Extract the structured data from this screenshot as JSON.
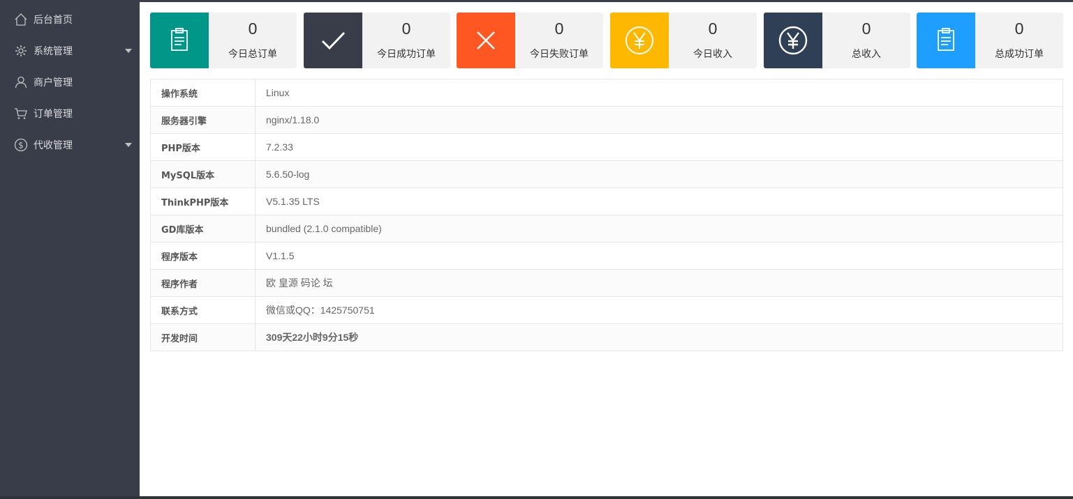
{
  "sidebar": {
    "items": [
      {
        "label": "后台首页",
        "icon": "home-icon",
        "has_submenu": false
      },
      {
        "label": "系统管理",
        "icon": "gear-icon",
        "has_submenu": true
      },
      {
        "label": "商户管理",
        "icon": "user-icon",
        "has_submenu": false
      },
      {
        "label": "订单管理",
        "icon": "cart-icon",
        "has_submenu": false
      },
      {
        "label": "代收管理",
        "icon": "dollar-icon",
        "has_submenu": true
      }
    ]
  },
  "stats": [
    {
      "value": "0",
      "label": "今日总订单",
      "icon": "clipboard-icon",
      "color": "#009688"
    },
    {
      "value": "0",
      "label": "今日成功订单",
      "icon": "check-icon",
      "color": "#393d49"
    },
    {
      "value": "0",
      "label": "今日失败订单",
      "icon": "close-icon",
      "color": "#ff5722"
    },
    {
      "value": "0",
      "label": "今日收入",
      "icon": "yen-icon",
      "color": "#ffb800"
    },
    {
      "value": "0",
      "label": "总收入",
      "icon": "yen-circle-icon",
      "color": "#2f4056"
    },
    {
      "value": "0",
      "label": "总成功订单",
      "icon": "clipboard-icon",
      "color": "#1e9fff"
    }
  ],
  "info_table": [
    {
      "key": "操作系统",
      "value": "Linux"
    },
    {
      "key": "服务器引擎",
      "value": "nginx/1.18.0"
    },
    {
      "key": "PHP版本",
      "value": "7.2.33"
    },
    {
      "key": "MySQL版本",
      "value": "5.6.50-log"
    },
    {
      "key": "ThinkPHP版本",
      "value": "V5.1.35 LTS"
    },
    {
      "key": "GD库版本",
      "value": "bundled (2.1.0 compatible)"
    },
    {
      "key": "程序版本",
      "value": "V1.1.5"
    },
    {
      "key": "程序作者",
      "value": "欧 皇源 码论 坛"
    },
    {
      "key": "联系方式",
      "value": "微信或QQ：1425750751"
    },
    {
      "key": "开发时间",
      "value": "309天22小时9分15秒"
    }
  ],
  "colors": {
    "sidebar_bg": "#393d49",
    "highlight_text": "#4f73a7"
  }
}
